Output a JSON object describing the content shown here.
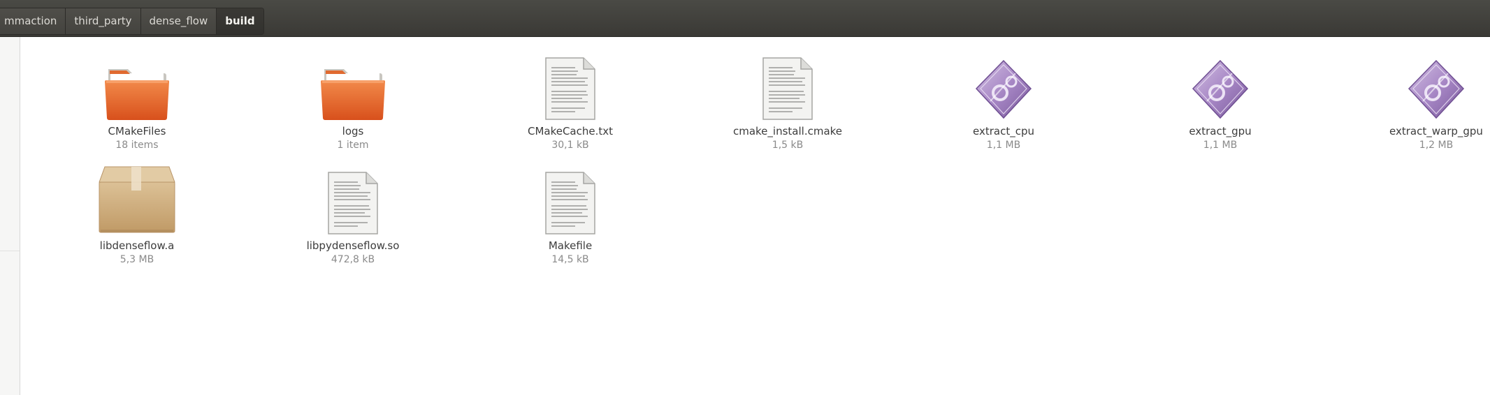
{
  "breadcrumb": {
    "segments": [
      {
        "label": "mmaction"
      },
      {
        "label": "third_party"
      },
      {
        "label": "dense_flow"
      },
      {
        "label": "build",
        "active": true
      }
    ]
  },
  "files": [
    {
      "name": "CMakeFiles",
      "meta": "18 items",
      "icon": "folder-icon"
    },
    {
      "name": "logs",
      "meta": "1 item",
      "icon": "folder-icon"
    },
    {
      "name": "CMakeCache.txt",
      "meta": "30,1 kB",
      "icon": "text-file-icon"
    },
    {
      "name": "cmake_install.cmake",
      "meta": "1,5 kB",
      "icon": "text-file-icon"
    },
    {
      "name": "extract_cpu",
      "meta": "1,1 MB",
      "icon": "executable-icon"
    },
    {
      "name": "extract_gpu",
      "meta": "1,1 MB",
      "icon": "executable-icon"
    },
    {
      "name": "extract_warp_gpu",
      "meta": "1,2 MB",
      "icon": "executable-icon"
    },
    {
      "name": "libdenseflow.a",
      "meta": "5,3 MB",
      "icon": "archive-package-icon"
    },
    {
      "name": "libpydenseflow.so",
      "meta": "472,8 kB",
      "icon": "text-file-icon"
    },
    {
      "name": "Makefile",
      "meta": "14,5 kB",
      "icon": "text-file-icon"
    }
  ],
  "colors": {
    "folder_orange": "#e9642a",
    "executable_purple": "#9b7bb8",
    "package_tan": "#cfae7e"
  }
}
